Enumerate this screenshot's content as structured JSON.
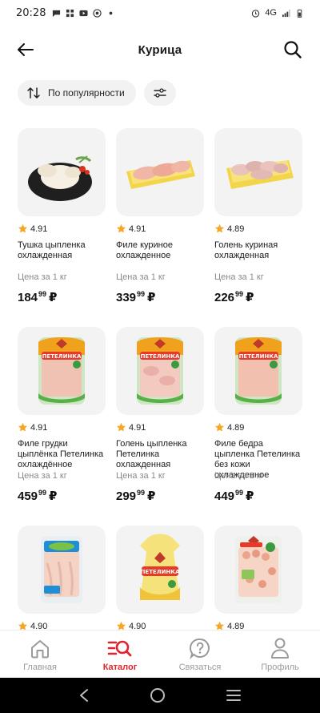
{
  "status_bar": {
    "time": "20:28",
    "network": "4G"
  },
  "header": {
    "title": "Курица"
  },
  "filters": {
    "sort_label": "По популярности"
  },
  "products": [
    {
      "rating": "4.91",
      "name": "Тушка цыпленка охлажденная",
      "per": "Цена за 1 кг",
      "price_int": "184",
      "price_frac": "99",
      "currency": "₽",
      "image": "whole-chicken-on-board"
    },
    {
      "rating": "4.91",
      "name": "Филе куриное охлажденное",
      "per": "Цена за 1 кг",
      "price_int": "339",
      "price_frac": "99",
      "currency": "₽",
      "image": "fillet-tray"
    },
    {
      "rating": "4.89",
      "name": "Голень куриная охлажденная",
      "per": "Цена за 1 кг",
      "price_int": "226",
      "price_frac": "99",
      "currency": "₽",
      "image": "drumstick-tray"
    },
    {
      "rating": "4.91",
      "name": "Филе грудки цыплёнка Петелинка охлаждённое",
      "per": "Цена за 1 кг",
      "price_int": "459",
      "price_frac": "99",
      "currency": "₽",
      "image": "petelinka-pack"
    },
    {
      "rating": "4.91",
      "name": "Голень цыпленка Петелинка охлажденная",
      "per": "Цена за 1 кг",
      "price_int": "299",
      "price_frac": "99",
      "currency": "₽",
      "image": "petelinka-pack"
    },
    {
      "rating": "4.89",
      "name": "Филе бедра цыпленка Петелинка без кожи охлажденное",
      "per": "Цена за 1 кг",
      "price_int": "449",
      "price_frac": "99",
      "currency": "₽",
      "image": "petelinka-pack"
    },
    {
      "rating": "4.90",
      "name": "",
      "per": "",
      "price_int": "",
      "price_frac": "",
      "currency": "",
      "image": "blue-label-fillet-pack"
    },
    {
      "rating": "4.90",
      "name": "",
      "per": "",
      "price_int": "",
      "price_frac": "",
      "currency": "",
      "image": "petelinka-whole-bag"
    },
    {
      "rating": "4.89",
      "name": "",
      "per": "",
      "price_int": "",
      "price_frac": "",
      "currency": "",
      "image": "petelinka-pieces-pack"
    }
  ],
  "pack_brand": "ПЕТЕЛИНКА",
  "bottom_nav": [
    {
      "label": "Главная",
      "icon": "home-icon"
    },
    {
      "label": "Каталог",
      "icon": "catalog-search-icon"
    },
    {
      "label": "Связаться",
      "icon": "help-icon"
    },
    {
      "label": "Профиль",
      "icon": "profile-icon"
    }
  ],
  "colors": {
    "accent": "#e0242e",
    "card_bg": "#f3f3f3",
    "star": "#f5a623",
    "muted": "#8a8a8a"
  }
}
